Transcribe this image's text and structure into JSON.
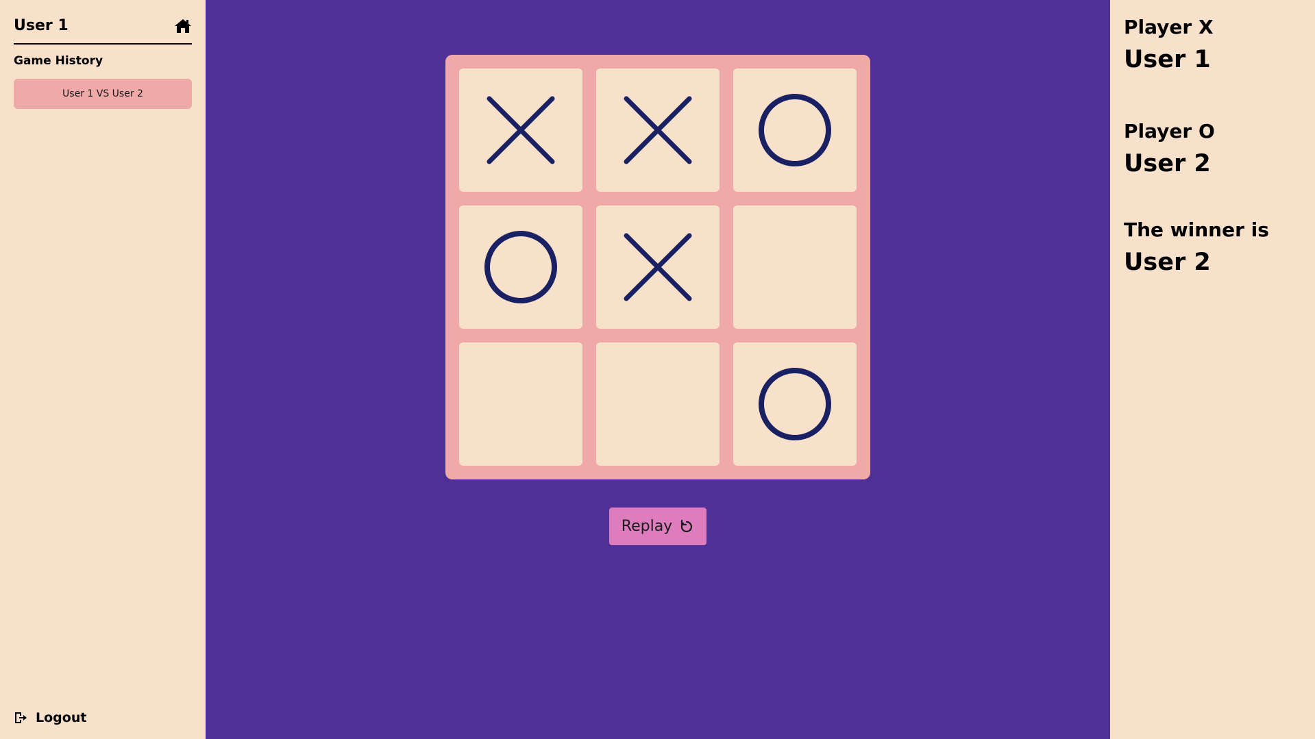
{
  "sidebar": {
    "username": "User 1",
    "history_title": "Game History",
    "history_items": [
      {
        "label": "User 1 VS User 2"
      }
    ],
    "logout_label": "Logout"
  },
  "icons": {
    "home": "home-icon",
    "logout": "logout-icon",
    "replay": "replay-icon"
  },
  "board": {
    "cells": [
      "X",
      "X",
      "O",
      "O",
      "X",
      "",
      "",
      "",
      "O"
    ]
  },
  "actions": {
    "replay_label": "Replay"
  },
  "players": {
    "x_title": "Player X",
    "x_name": "User 1",
    "o_title": "Player O",
    "o_name": "User 2",
    "winner_title": "The winner is",
    "winner_name": "User 2"
  },
  "colors": {
    "background": "#4f3096",
    "panel": "#f8e1ca",
    "board": "#efa9a8",
    "mark": "#1a2163",
    "replay_button": "#de7dbe"
  }
}
